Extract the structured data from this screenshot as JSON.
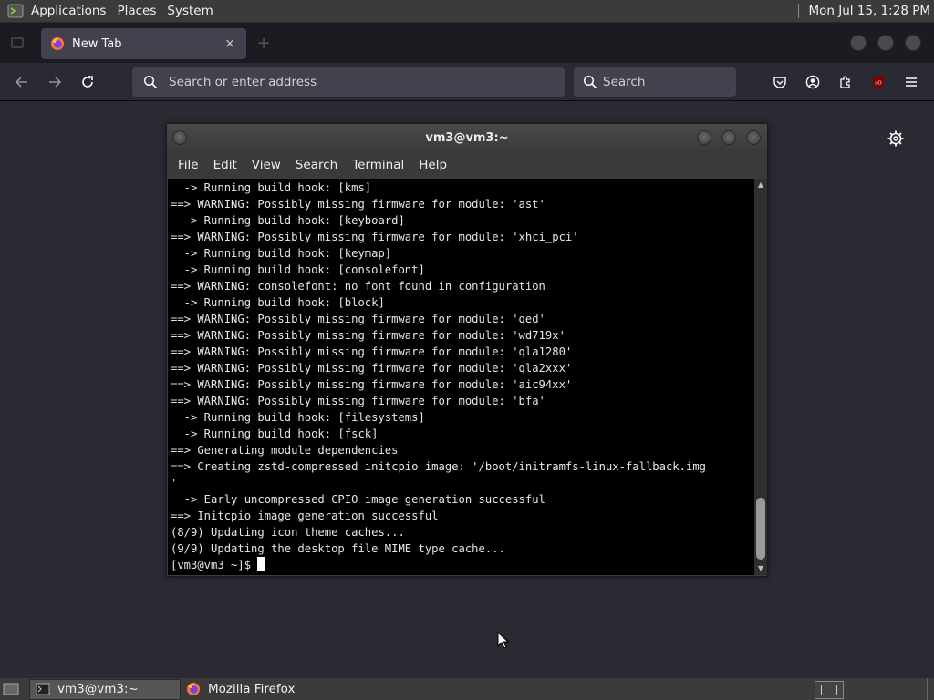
{
  "top_panel": {
    "menus": [
      "Applications",
      "Places",
      "System"
    ],
    "clock": "Mon Jul 15,  1:28 PM"
  },
  "browser": {
    "tab": {
      "title": "New Tab",
      "close": "×"
    },
    "url_placeholder": "Search or enter address",
    "search_placeholder": "Search"
  },
  "terminal": {
    "title": "vm3@vm3:~",
    "menu": [
      "File",
      "Edit",
      "View",
      "Search",
      "Terminal",
      "Help"
    ],
    "lines": [
      "  -> Running build hook: [kms]",
      "==> WARNING: Possibly missing firmware for module: 'ast'",
      "  -> Running build hook: [keyboard]",
      "==> WARNING: Possibly missing firmware for module: 'xhci_pci'",
      "  -> Running build hook: [keymap]",
      "  -> Running build hook: [consolefont]",
      "==> WARNING: consolefont: no font found in configuration",
      "  -> Running build hook: [block]",
      "==> WARNING: Possibly missing firmware for module: 'qed'",
      "==> WARNING: Possibly missing firmware for module: 'wd719x'",
      "==> WARNING: Possibly missing firmware for module: 'qla1280'",
      "==> WARNING: Possibly missing firmware for module: 'qla2xxx'",
      "==> WARNING: Possibly missing firmware for module: 'aic94xx'",
      "==> WARNING: Possibly missing firmware for module: 'bfa'",
      "  -> Running build hook: [filesystems]",
      "  -> Running build hook: [fsck]",
      "==> Generating module dependencies",
      "==> Creating zstd-compressed initcpio image: '/boot/initramfs-linux-fallback.img",
      "'",
      "  -> Early uncompressed CPIO image generation successful",
      "==> Initcpio image generation successful",
      "(8/9) Updating icon theme caches...",
      "(9/9) Updating the desktop file MIME type cache..."
    ],
    "prompt": "[vm3@vm3 ~]$ "
  },
  "taskbar": {
    "items": [
      {
        "label": "vm3@vm3:~",
        "active": true
      },
      {
        "label": "Mozilla Firefox",
        "active": false
      }
    ]
  },
  "icons": {
    "app_menu": "terminal-app-icon",
    "firefox": "firefox-icon",
    "gear": "gear-icon"
  },
  "colors": {
    "desktop_bg": "#2b2a33",
    "terminal_bg": "#000000",
    "panel_bg": "#3b3b3b"
  }
}
